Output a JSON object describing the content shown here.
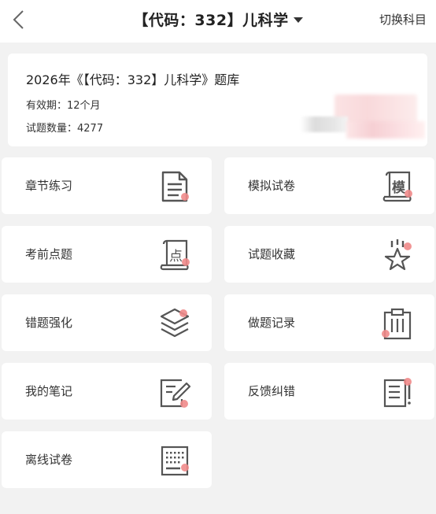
{
  "header": {
    "title": "【代码：332】儿科学",
    "switch_label": "切换科目"
  },
  "info": {
    "bank_title": "2026年《【代码：332】儿科学》题库",
    "validity": "有效期：12个月",
    "question_count": "试题数量：4277"
  },
  "tiles": [
    {
      "label": "章节练习",
      "icon": "document-icon"
    },
    {
      "label": "模拟试卷",
      "icon": "scroll-mock-icon"
    },
    {
      "label": "考前点题",
      "icon": "scroll-point-icon"
    },
    {
      "label": "试题收藏",
      "icon": "star-icon"
    },
    {
      "label": "错题强化",
      "icon": "layers-icon"
    },
    {
      "label": "做题记录",
      "icon": "clipboard-icon"
    },
    {
      "label": "我的笔记",
      "icon": "note-pencil-icon"
    },
    {
      "label": "反馈纠错",
      "icon": "feedback-list-icon"
    },
    {
      "label": "离线试卷",
      "icon": "offline-paper-icon"
    }
  ],
  "icon_glyphs": {
    "mock": "模",
    "point": "点"
  },
  "colors": {
    "accent_dot": "#f08a8a",
    "icon_stroke": "#555555"
  }
}
